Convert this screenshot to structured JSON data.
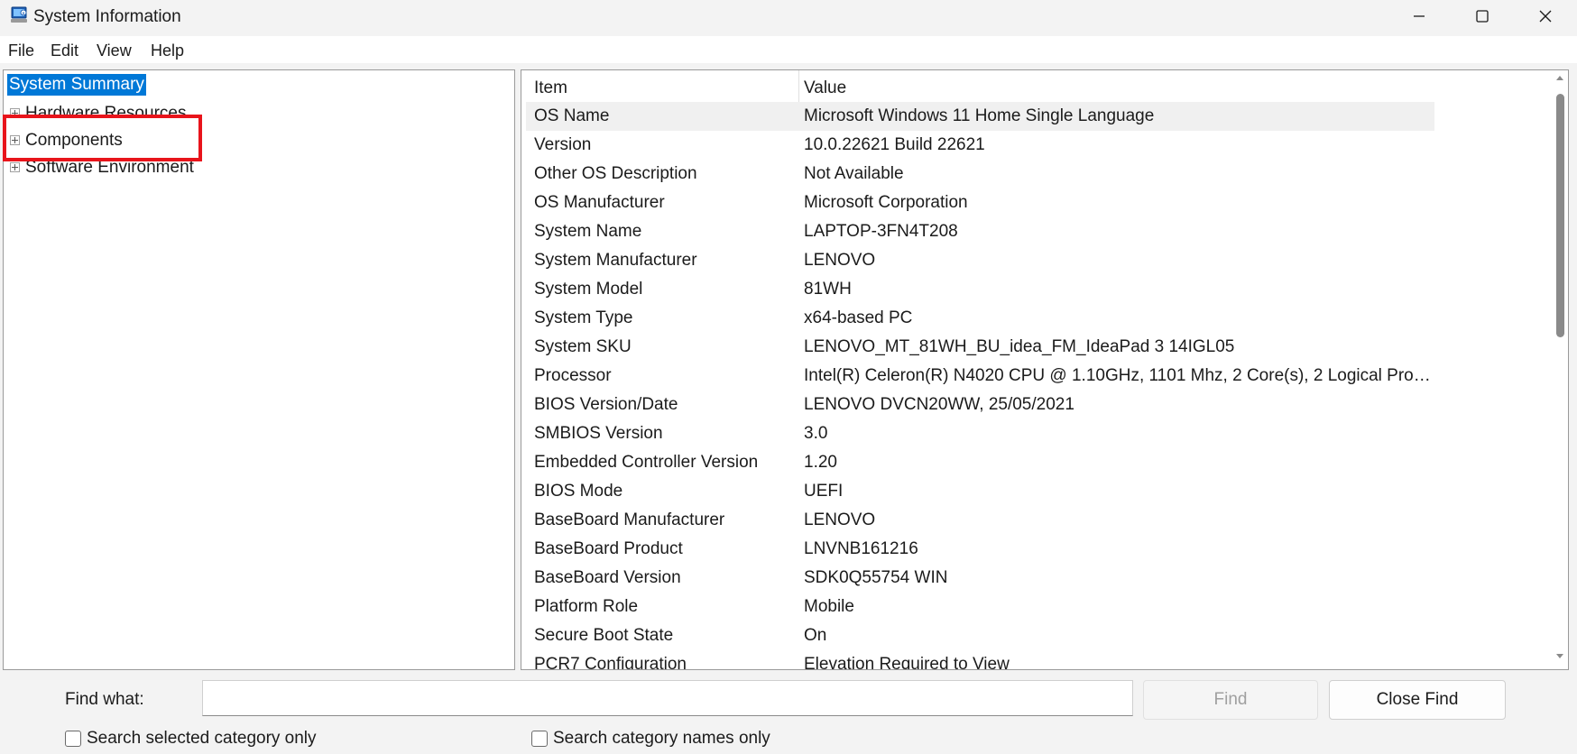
{
  "window": {
    "title": "System Information",
    "icon": "system-information-icon"
  },
  "menu": {
    "items": [
      "File",
      "Edit",
      "View",
      "Help"
    ]
  },
  "tree": {
    "items": [
      {
        "label": "System Summary",
        "selected": true,
        "expandable": false
      },
      {
        "label": "Hardware Resources",
        "selected": false,
        "expandable": true
      },
      {
        "label": "Components",
        "selected": false,
        "expandable": true
      },
      {
        "label": "Software Environment",
        "selected": false,
        "expandable": true
      }
    ],
    "highlight_color": "#e8141b",
    "selection_color": "#0078d7"
  },
  "details": {
    "columns": {
      "item": "Item",
      "value": "Value"
    },
    "rows": [
      {
        "item": "OS Name",
        "value": "Microsoft Windows 11 Home Single Language"
      },
      {
        "item": "Version",
        "value": "10.0.22621 Build 22621"
      },
      {
        "item": "Other OS Description",
        "value": "Not Available"
      },
      {
        "item": "OS Manufacturer",
        "value": "Microsoft Corporation"
      },
      {
        "item": "System Name",
        "value": "LAPTOP-3FN4T208"
      },
      {
        "item": "System Manufacturer",
        "value": "LENOVO"
      },
      {
        "item": "System Model",
        "value": "81WH"
      },
      {
        "item": "System Type",
        "value": "x64-based PC"
      },
      {
        "item": "System SKU",
        "value": "LENOVO_MT_81WH_BU_idea_FM_IdeaPad 3 14IGL05"
      },
      {
        "item": "Processor",
        "value": "Intel(R) Celeron(R) N4020 CPU @ 1.10GHz, 1101 Mhz, 2 Core(s), 2 Logical Proc..."
      },
      {
        "item": "BIOS Version/Date",
        "value": "LENOVO DVCN20WW, 25/05/2021"
      },
      {
        "item": "SMBIOS Version",
        "value": "3.0"
      },
      {
        "item": "Embedded Controller Version",
        "value": "1.20"
      },
      {
        "item": "BIOS Mode",
        "value": "UEFI"
      },
      {
        "item": "BaseBoard Manufacturer",
        "value": "LENOVO"
      },
      {
        "item": "BaseBoard Product",
        "value": "LNVNB161216"
      },
      {
        "item": "BaseBoard Version",
        "value": "SDK0Q55754 WIN"
      },
      {
        "item": "Platform Role",
        "value": "Mobile"
      },
      {
        "item": "Secure Boot State",
        "value": "On"
      },
      {
        "item": "PCR7 Configuration",
        "value": "Elevation Required to View"
      }
    ]
  },
  "find": {
    "label": "Find what:",
    "value": "",
    "find_button": "Find",
    "find_button_enabled": false,
    "close_button": "Close Find",
    "option_selected_category": "Search selected category only",
    "option_category_names": "Search category names only",
    "option_selected_category_checked": false,
    "option_category_names_checked": false
  }
}
